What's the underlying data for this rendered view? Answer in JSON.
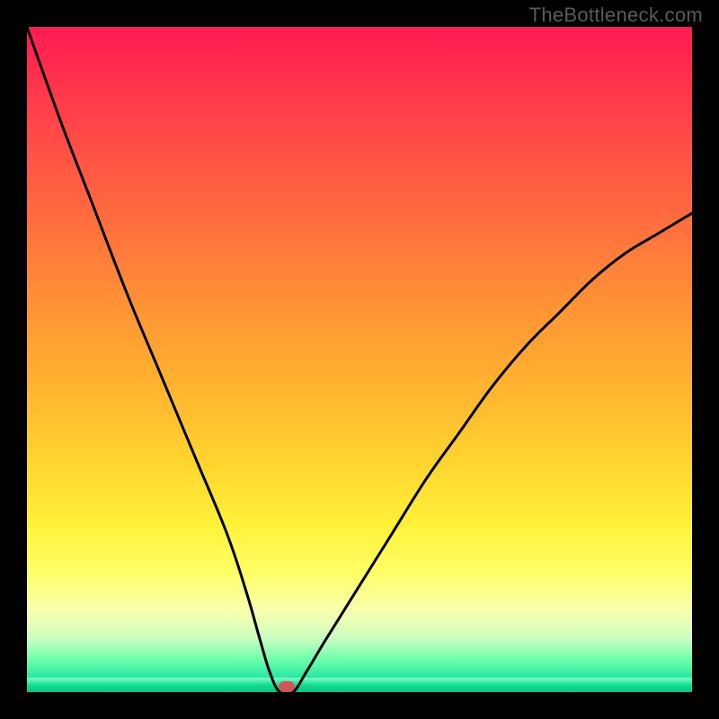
{
  "watermark": "TheBottleneck.com",
  "chart_data": {
    "type": "line",
    "title": "",
    "xlabel": "",
    "ylabel": "",
    "xlim": [
      0,
      100
    ],
    "ylim": [
      0,
      100
    ],
    "grid": false,
    "legend": false,
    "series": [
      {
        "name": "bottleneck-curve",
        "x": [
          0,
          5,
          10,
          15,
          20,
          25,
          30,
          33,
          35,
          36.5,
          38,
          40,
          42,
          45,
          50,
          55,
          60,
          65,
          70,
          75,
          80,
          85,
          90,
          95,
          100
        ],
        "y": [
          100,
          86,
          73,
          60,
          48,
          36,
          24,
          15,
          8,
          3,
          0,
          0,
          3,
          8,
          16,
          24,
          32,
          39,
          46,
          52,
          57,
          62,
          66,
          69,
          72
        ]
      }
    ],
    "marker": {
      "x": 39,
      "y": 0,
      "color": "#d35455"
    },
    "background": {
      "type": "vertical-gradient",
      "stops": [
        {
          "pos": 0.0,
          "color": "#ff1a52"
        },
        {
          "pos": 0.55,
          "color": "#ffb62f"
        },
        {
          "pos": 0.82,
          "color": "#ffff66"
        },
        {
          "pos": 1.0,
          "color": "#00d490"
        }
      ]
    }
  }
}
